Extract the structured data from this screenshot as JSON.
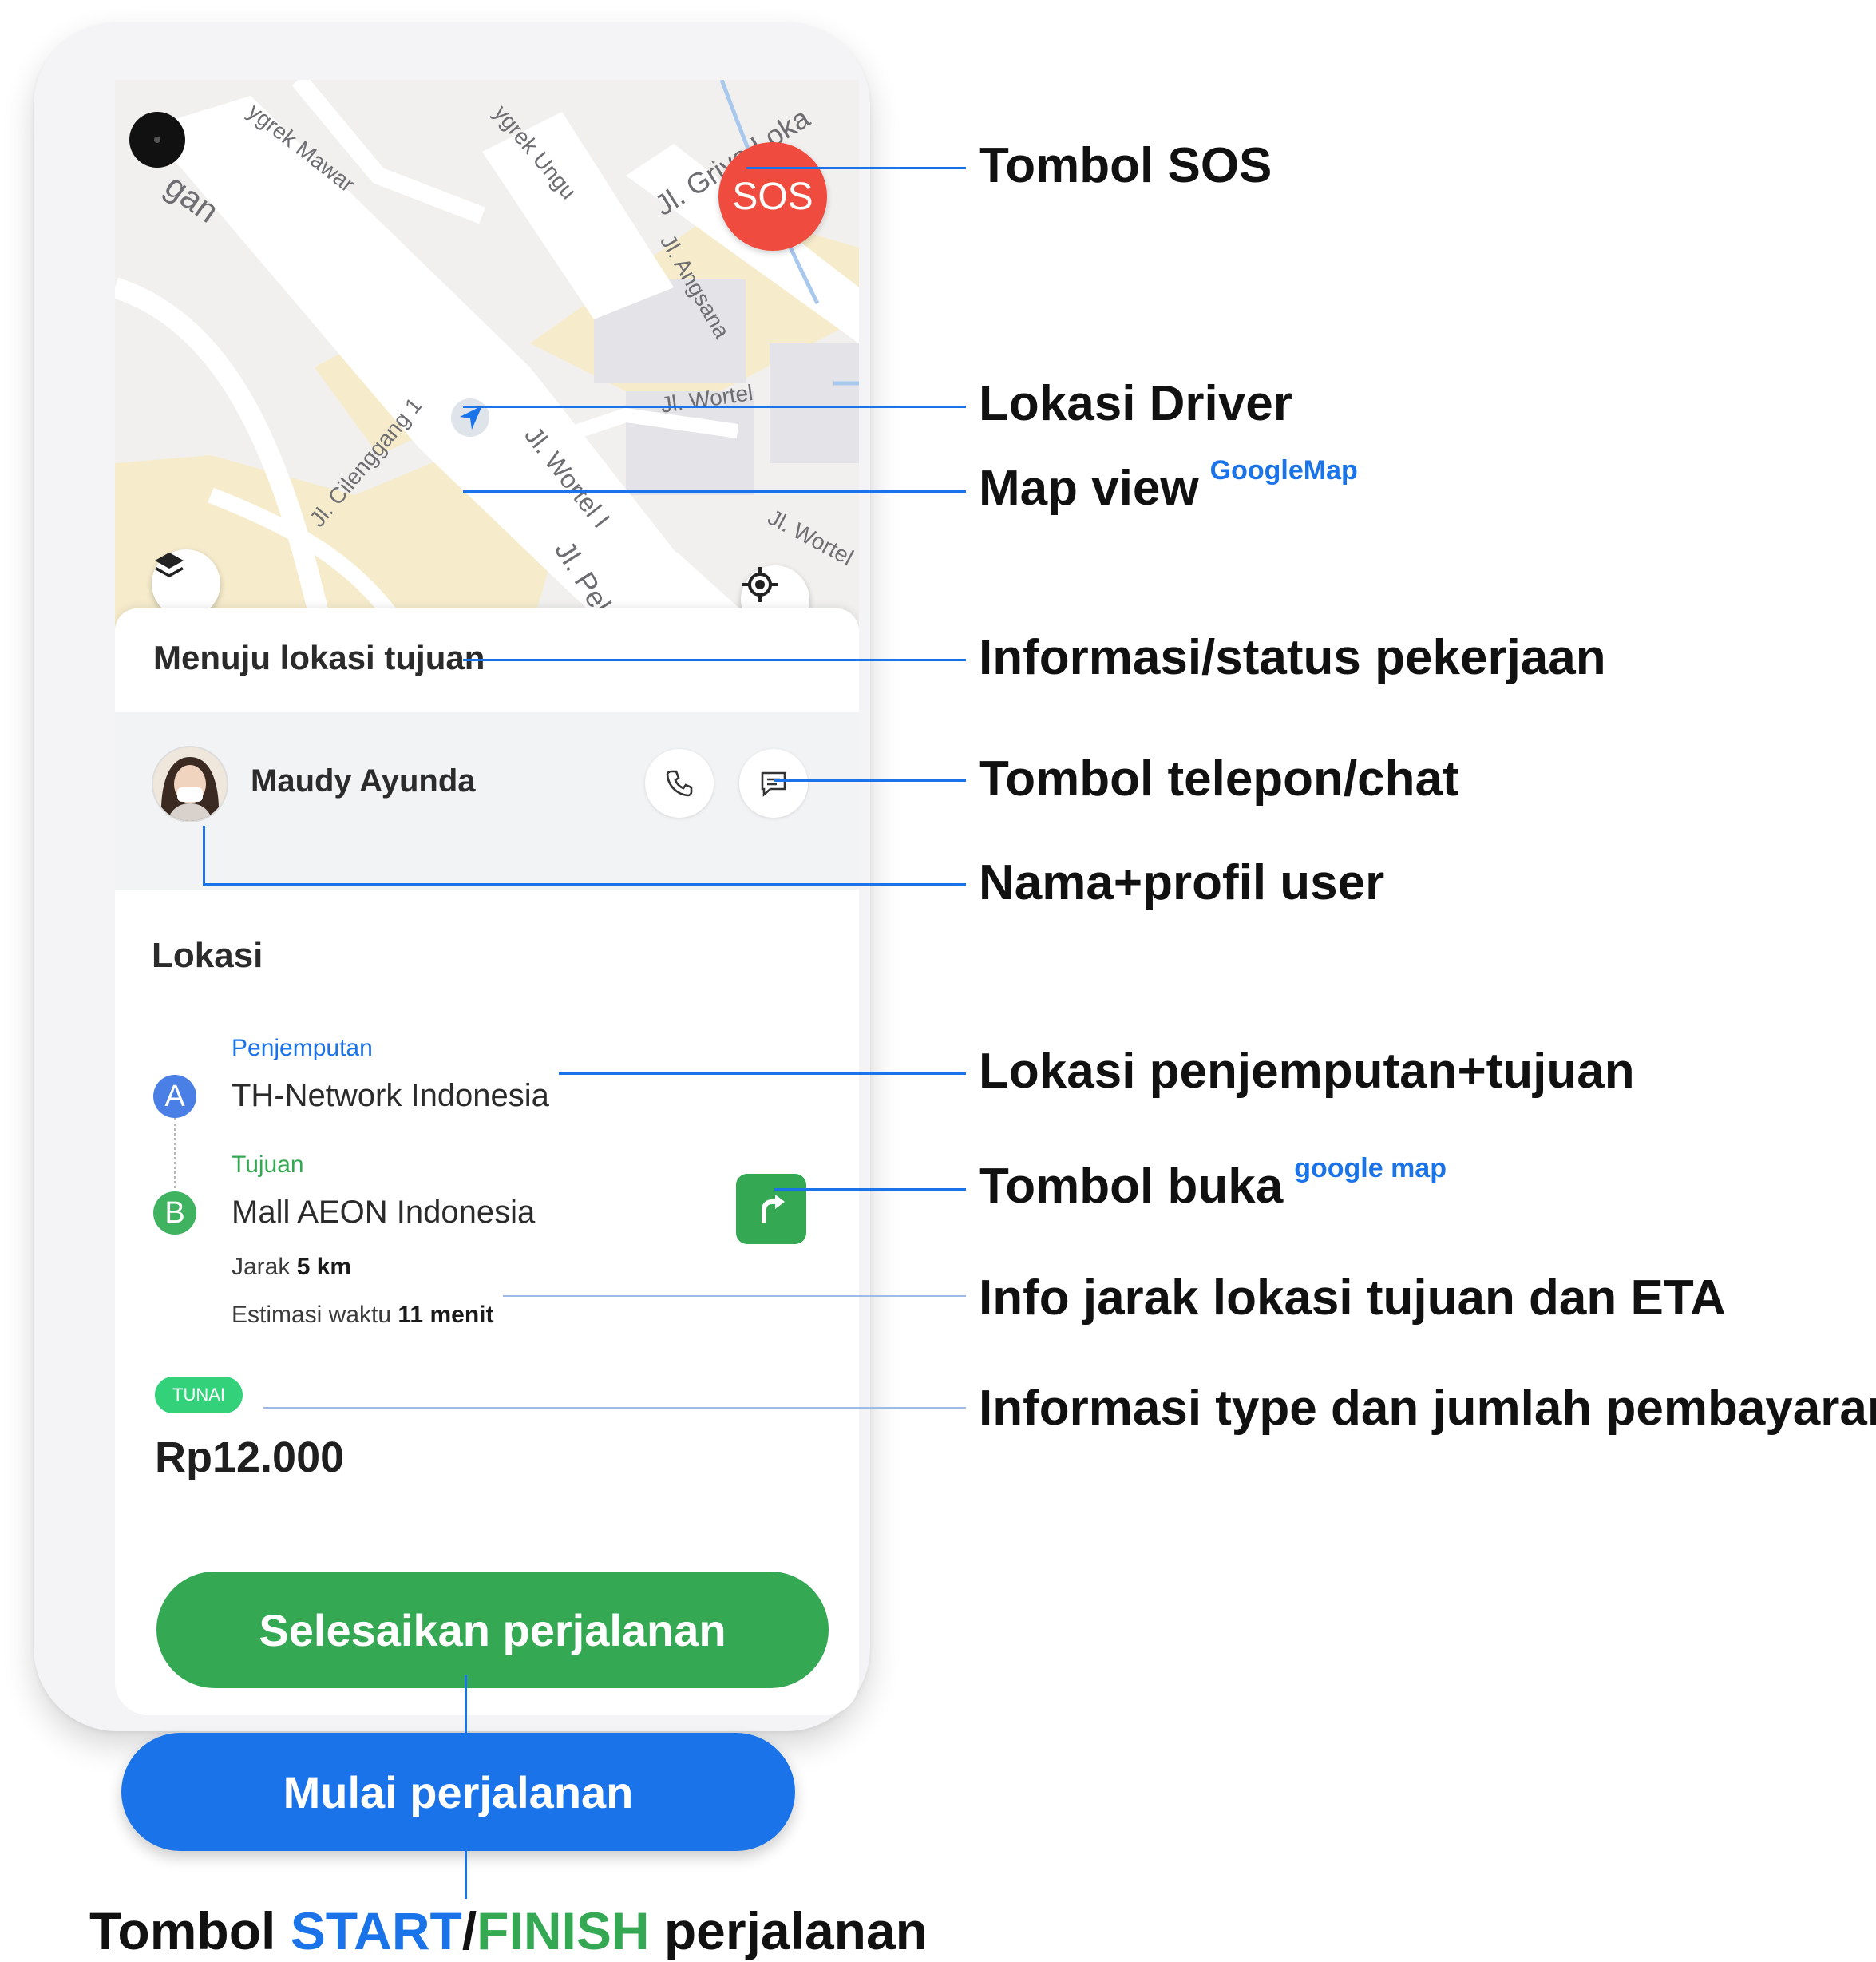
{
  "map": {
    "sos_label": "SOS",
    "streets": [
      "ygrek Mawar",
      "ygrek Ungu",
      "Jl. Griya Loka",
      "Jl. Angsana",
      "Jl. Wortel",
      "Jl. Cilenggang 1",
      "Jl. Wortel I",
      "Jl. Wortel",
      "Jl. Pelay",
      "gan"
    ],
    "icons": {
      "layers": "layers-icon",
      "recenter": "my-location-icon",
      "driver": "navigation-arrow-icon"
    }
  },
  "trip": {
    "status": "Menuju lokasi tujuan",
    "user_name": "Maudy Ayunda",
    "locations_title": "Lokasi",
    "pickup": {
      "marker": "A",
      "label": "Penjemputan",
      "name": "TH-Network Indonesia"
    },
    "destination": {
      "marker": "B",
      "label": "Tujuan",
      "name": "Mall AEON Indonesia"
    },
    "distance_label": "Jarak",
    "distance_value": "5 km",
    "eta_label": "Estimasi waktu",
    "eta_value": "11 menit",
    "payment_type": "TUNAI",
    "payment_amount": "Rp12.000",
    "finish_button": "Selesaikan perjalanan",
    "start_button": "Mulai perjalanan"
  },
  "annotations": {
    "sos": "Tombol SOS",
    "driver_location": "Lokasi Driver",
    "map_view": "Map view",
    "map_view_sup": "GoogleMap",
    "status_info": "Informasi/status pekerjaan",
    "call_chat": "Tombol telepon/chat",
    "user_profile": "Nama+profil user",
    "pickup_dest": "Lokasi penjemputan+tujuan",
    "open_map": "Tombol buka",
    "open_map_sup": "google map",
    "distance_eta": "Info jarak lokasi tujuan dan ETA",
    "payment_info": "Informasi type dan jumlah pembayaran",
    "caption_prefix": "Tombol",
    "caption_start": "START",
    "caption_sep": "/",
    "caption_finish": "FINISH",
    "caption_suffix": "perjalanan"
  },
  "colors": {
    "blue": "#1a73e8",
    "green": "#34a853",
    "sos_red": "#ef4c3f",
    "badge_green": "#33d17a"
  }
}
